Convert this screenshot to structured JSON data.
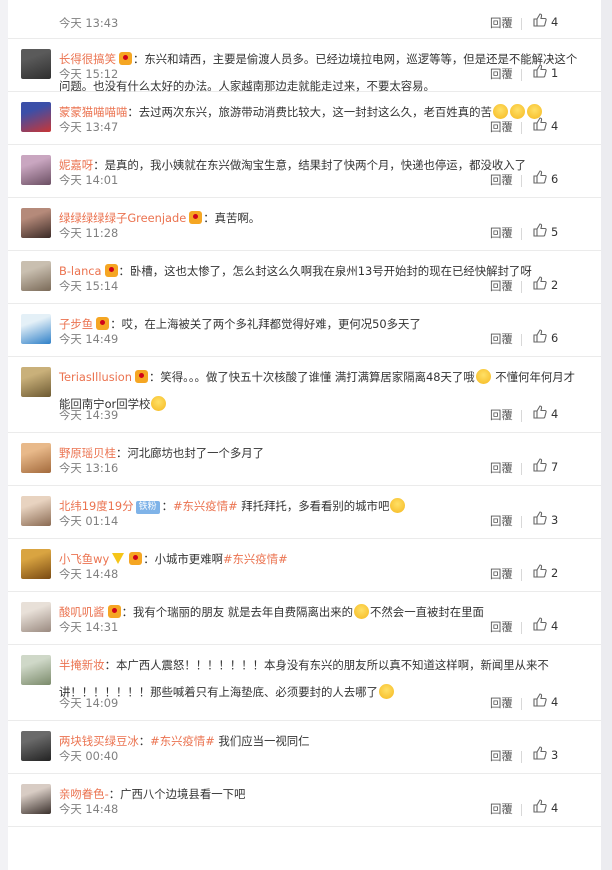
{
  "reply_label": "回覆",
  "top_partial": {
    "time": "今天 13:43",
    "likes": "4"
  },
  "comments": [
    {
      "user": "长得很搞笑",
      "badge": "crown",
      "text": "：东兴和靖西，主要是偷渡人员多。已经边境拉电网，巡逻等等，但是还是不能解决这个问题。也没有什么太好的办法。人家越南那边走就能走过来，不要太容易。",
      "time": "今天 15:12",
      "likes": "1",
      "avatar": [
        "#5a5a5a",
        "#2f2f2f"
      ]
    },
    {
      "user": "蒙蒙猫喵喵喵",
      "badge": "",
      "text": "：去过两次东兴，旅游带动消费比较大，这一封封这么久，老百姓真的苦",
      "emoji_count": 3,
      "time": "今天 13:47",
      "likes": "4",
      "avatar": [
        "#3b4fa8",
        "#c93636"
      ]
    },
    {
      "user": "妮嘉呀",
      "badge": "",
      "text": "：是真的，我小姨就在东兴做淘宝生意，结果封了快两个月，快递也停运，都没收入了",
      "time": "今天 14:01",
      "likes": "6",
      "avatar": [
        "#c9a6c0",
        "#6b4f63"
      ]
    },
    {
      "user": "绿绿绿绿绿子Greenjade",
      "badge": "crown",
      "text": "：真苦啊。",
      "time": "今天 11:28",
      "likes": "5",
      "avatar": [
        "#b58a7a",
        "#3a2a26"
      ]
    },
    {
      "user": "B-lanca",
      "badge": "crown",
      "text": "：卧槽，这也太惨了，怎么封这么久啊我在泉州13号开始封的现在已经快解封了呀",
      "time": "今天 15:14",
      "likes": "2",
      "avatar": [
        "#c9bfb0",
        "#7a6a58"
      ]
    },
    {
      "user": "子步鱼",
      "badge": "crown",
      "text": "：哎，在上海被关了两个多礼拜都觉得好难，更何况50多天了",
      "time": "今天 14:49",
      "likes": "6",
      "avatar": [
        "#e4f0f7",
        "#2f80c8"
      ]
    },
    {
      "user": "TeriasIllusion",
      "badge": "crown",
      "text": "：笑得。。。做了快五十次核酸了谁懂 满打满算居家隔离48天了哦",
      "text2": " 不懂何年何月才能回南宁or回学校",
      "time": "今天 14:39",
      "likes": "4",
      "avatar": [
        "#c9b07a",
        "#6d5a32"
      ]
    },
    {
      "user": "野原瑶贝桂",
      "badge": "",
      "text": "：河北廊坊也封了一个多月了",
      "time": "今天 13:16",
      "likes": "7",
      "avatar": [
        "#e8b98a",
        "#a36a3c"
      ]
    },
    {
      "user": "北纬19度19分",
      "badge": "",
      "fan": "铁粉",
      "text": "：",
      "topic": "#东兴疫情#",
      "text_after": " 拜托拜托，多看看别的城市吧",
      "time": "今天 01:14",
      "likes": "3",
      "avatar": [
        "#e8d3c0",
        "#8a6a52"
      ]
    },
    {
      "user": "小飞鱼wy",
      "badge": "vcrown",
      "text": "：小城市更难啊",
      "topic": "#东兴疫情#",
      "time": "今天 14:48",
      "likes": "2",
      "avatar": [
        "#d9a441",
        "#7a4a12"
      ]
    },
    {
      "user": "酸叽叽酱",
      "badge": "crown",
      "text": "：我有个瑞丽的朋友 就是去年自费隔离出来的",
      "text2": "不然会一直被封在里面",
      "time": "今天 14:31",
      "likes": "4",
      "avatar": [
        "#e8e0d8",
        "#9a8a80"
      ]
    },
    {
      "user": "半掩新妆",
      "badge": "",
      "text": "：本广西人震怒！！！！！！！本身没有东兴的朋友所以真不知道这样啊，新闻里从来不讲！！！！！！！那些喊着只有上海垫底、必须要封的人去哪了",
      "emoji_count": 1,
      "time": "今天 14:09",
      "likes": "4",
      "avatar": [
        "#cfd8c8",
        "#7a8a6a"
      ]
    },
    {
      "user": "两块钱买绿豆冰",
      "badge": "",
      "text": "：",
      "topic": "#东兴疫情#",
      "text_after": " 我们应当一视同仁",
      "time": "今天 00:40",
      "likes": "3",
      "avatar": [
        "#6a6a6a",
        "#222222"
      ]
    },
    {
      "user": "亲吻眷色-",
      "badge": "",
      "text": "：广西八个边境县看一下吧",
      "time": "今天 14:48",
      "likes": "4",
      "avatar": [
        "#d8ccc4",
        "#3a302c"
      ]
    }
  ]
}
